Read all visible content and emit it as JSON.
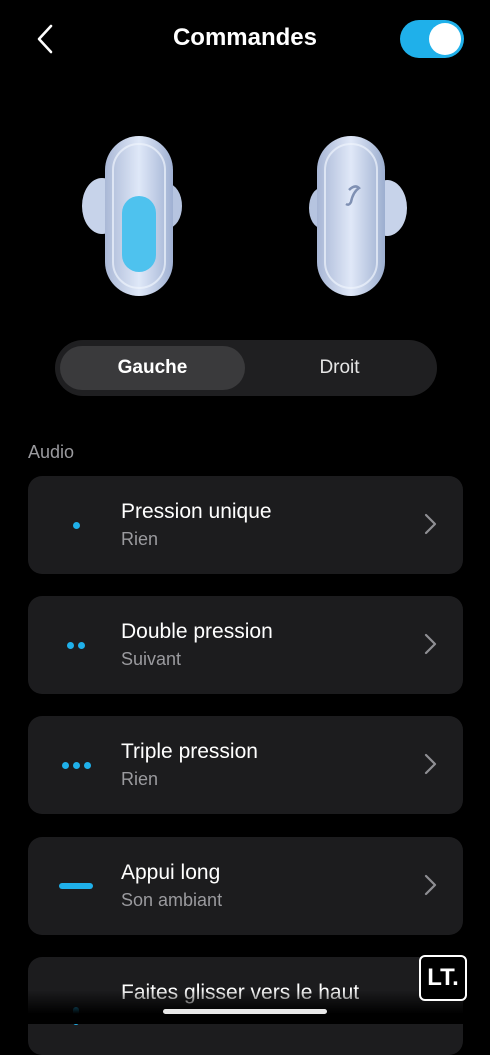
{
  "header": {
    "title": "Commandes",
    "toggle_on": true
  },
  "colors": {
    "accent": "#1fb0ea",
    "card_bg": "#1c1c1e",
    "segment_bg": "#1f1f21",
    "segment_active": "#3a3a3c"
  },
  "tabs": [
    {
      "label": "Gauche",
      "active": true
    },
    {
      "label": "Droit",
      "active": false
    }
  ],
  "section": {
    "label": "Audio"
  },
  "controls": [
    {
      "icon": "single-dot-icon",
      "name": "Pression unique",
      "value": "Rien"
    },
    {
      "icon": "double-dot-icon",
      "name": "Double pression",
      "value": "Suivant"
    },
    {
      "icon": "triple-dot-icon",
      "name": "Triple pression",
      "value": "Rien"
    },
    {
      "icon": "long-press-icon",
      "name": "Appui long",
      "value": "Son ambiant"
    },
    {
      "icon": "swipe-up-icon",
      "name": "Faites glisser vers le haut",
      "value": ""
    }
  ],
  "watermark": {
    "text": "LT."
  }
}
